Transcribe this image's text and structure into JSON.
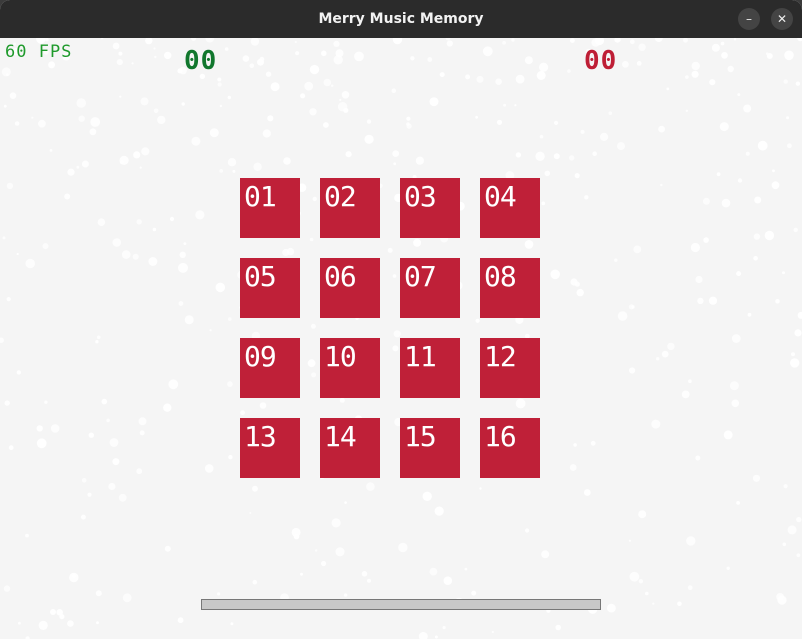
{
  "window": {
    "title": "Merry Music Memory",
    "minimize_glyph": "–",
    "close_glyph": "✕"
  },
  "hud": {
    "fps": "60 FPS",
    "score_green": "00",
    "score_red": "00"
  },
  "cards": [
    {
      "label": "01"
    },
    {
      "label": "02"
    },
    {
      "label": "03"
    },
    {
      "label": "04"
    },
    {
      "label": "05"
    },
    {
      "label": "06"
    },
    {
      "label": "07"
    },
    {
      "label": "08"
    },
    {
      "label": "09"
    },
    {
      "label": "10"
    },
    {
      "label": "11"
    },
    {
      "label": "12"
    },
    {
      "label": "13"
    },
    {
      "label": "14"
    },
    {
      "label": "15"
    },
    {
      "label": "16"
    }
  ],
  "progress": {
    "value": 0
  },
  "colors": {
    "card": "#bf2038",
    "fps": "#1f9a2c",
    "score_green": "#11772d",
    "score_red": "#be1e35",
    "background": "#f5f5f5",
    "snow": "#ffffff"
  }
}
